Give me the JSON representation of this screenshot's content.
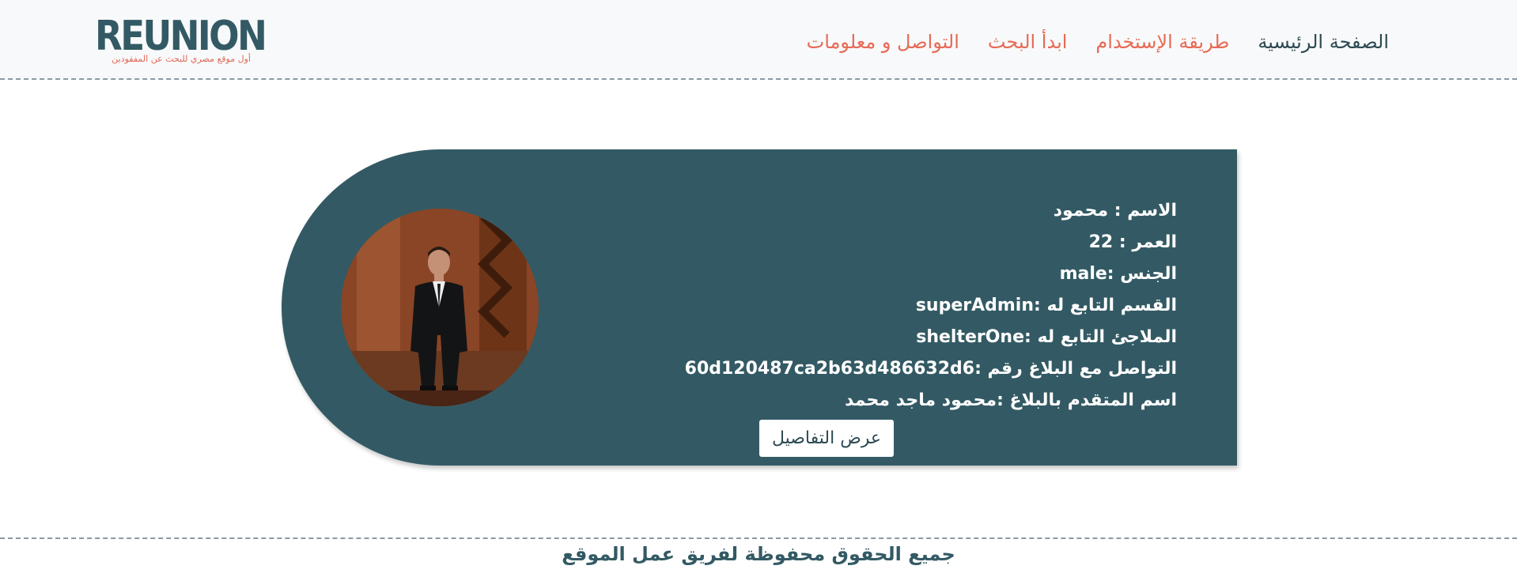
{
  "header": {
    "logo": {
      "word": "REUNION",
      "tagline": "أول موقع مصري للبحث عن المفقودين"
    },
    "nav": [
      {
        "label": "الصفحة الرئيسية",
        "active": true
      },
      {
        "label": "طريقة الإستخدام",
        "active": false
      },
      {
        "label": "ابدأ البحث",
        "active": false
      },
      {
        "label": "التواصل و معلومات",
        "active": false
      }
    ]
  },
  "card": {
    "photo_alt": "person-photo",
    "fields": [
      "الاسم : محمود",
      "العمر : 22",
      "الجنس :male",
      "القسم التابع له :superAdmin",
      "الملاجئ التابع له :shelterOne",
      "التواصل مع البلاغ رقم :60d120487ca2b63d486632d6",
      "اسم المتقدم بالبلاغ :محمود ماجد محمد"
    ],
    "details_button": "عرض التفاصيل"
  },
  "footer": {
    "copyright": "جميع الحقوق محفوظة لفريق عمل الموقع"
  },
  "colors": {
    "brand": "#335a64",
    "accent": "#e76a55",
    "header_bg": "#f8f9fa"
  }
}
